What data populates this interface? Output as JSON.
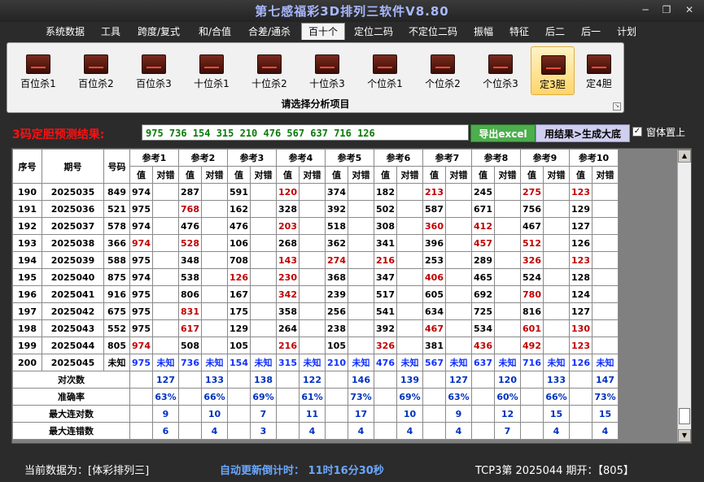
{
  "window": {
    "title": "第七感福彩3D排列三软件V8.80",
    "minimize": "─",
    "restore": "❐",
    "close": "✕"
  },
  "menu": [
    {
      "label": "系统数据",
      "active": false
    },
    {
      "label": "工具",
      "active": false
    },
    {
      "label": "跨度/复式",
      "active": false
    },
    {
      "label": "和/合值",
      "active": false
    },
    {
      "label": "合差/通杀",
      "active": false
    },
    {
      "label": "百十个",
      "active": true
    },
    {
      "label": "定位二码",
      "active": false
    },
    {
      "label": "不定位二码",
      "active": false
    },
    {
      "label": "振幅",
      "active": false
    },
    {
      "label": "特征",
      "active": false
    },
    {
      "label": "后二",
      "active": false
    },
    {
      "label": "后一",
      "active": false
    },
    {
      "label": "计划",
      "active": false
    }
  ],
  "ribbon": {
    "buttons": [
      {
        "label": "百位杀1",
        "icon": "chart-icon",
        "selected": false
      },
      {
        "label": "百位杀2",
        "icon": "chart-icon",
        "selected": false
      },
      {
        "label": "百位杀3",
        "icon": "chart-icon",
        "selected": false
      },
      {
        "label": "十位杀1",
        "icon": "chart-icon",
        "selected": false
      },
      {
        "label": "十位杀2",
        "icon": "chart-icon",
        "selected": false
      },
      {
        "label": "十位杀3",
        "icon": "chart-icon",
        "selected": false
      },
      {
        "label": "个位杀1",
        "icon": "chart-icon",
        "selected": false
      },
      {
        "label": "个位杀2",
        "icon": "chart-icon",
        "selected": false
      },
      {
        "label": "个位杀3",
        "icon": "chart-icon",
        "selected": false
      },
      {
        "label": "定3胆",
        "icon": "chart-icon",
        "selected": true
      },
      {
        "label": "定4胆",
        "icon": "chart-icon",
        "selected": false
      }
    ],
    "caption": "请选择分析项目"
  },
  "prediction": {
    "label": "3码定胆预测结果:",
    "value": "975  736  154  315  210  476  567  637  716  126",
    "export_label": "导出excel",
    "generate_label": "用结果>生成大底",
    "pin_label": "窗体置上",
    "pin_checked": true
  },
  "table": {
    "headers": {
      "seq": "序号",
      "period": "期号",
      "code": "号码",
      "value": "值",
      "check": "对错"
    },
    "refs": [
      "参考1",
      "参考2",
      "参考3",
      "参考4",
      "参考5",
      "参考6",
      "参考7",
      "参考8",
      "参考9",
      "参考10"
    ],
    "rows": [
      {
        "seq": "190",
        "period": "2025035",
        "code": "849",
        "cells": [
          [
            "974",
            "对2"
          ],
          [
            "287",
            "对1"
          ],
          [
            "591",
            "对1"
          ],
          [
            "120",
            ""
          ],
          [
            "374",
            "对1"
          ],
          [
            "182",
            "对1"
          ],
          [
            "213",
            ""
          ],
          [
            "245",
            "对1"
          ],
          [
            "275",
            ""
          ],
          [
            "123",
            ""
          ]
        ]
      },
      {
        "seq": "191",
        "period": "2025036",
        "code": "521",
        "cells": [
          [
            "975",
            "对1"
          ],
          [
            "768",
            ""
          ],
          [
            "162",
            "对2"
          ],
          [
            "328",
            "对1"
          ],
          [
            "392",
            "对1"
          ],
          [
            "502",
            "对2"
          ],
          [
            "587",
            "对1"
          ],
          [
            "671",
            "对1"
          ],
          [
            "756",
            "对1"
          ],
          [
            "129",
            "对2"
          ]
        ]
      },
      {
        "seq": "192",
        "period": "2025037",
        "code": "578",
        "cells": [
          [
            "974",
            "对1"
          ],
          [
            "476",
            "对1"
          ],
          [
            "476",
            "对1"
          ],
          [
            "203",
            ""
          ],
          [
            "518",
            "对2"
          ],
          [
            "308",
            "对1"
          ],
          [
            "360",
            ""
          ],
          [
            "412",
            ""
          ],
          [
            "467",
            "对1"
          ],
          [
            "127",
            "对1"
          ]
        ]
      },
      {
        "seq": "193",
        "period": "2025038",
        "code": "366",
        "cells": [
          [
            "974",
            ""
          ],
          [
            "528",
            ""
          ],
          [
            "106",
            "对2"
          ],
          [
            "268",
            "对2"
          ],
          [
            "362",
            "对3"
          ],
          [
            "341",
            "对1"
          ],
          [
            "396",
            "对3"
          ],
          [
            "457",
            ""
          ],
          [
            "512",
            ""
          ],
          [
            "126",
            "对2"
          ]
        ]
      },
      {
        "seq": "194",
        "period": "2025039",
        "code": "588",
        "cells": [
          [
            "975",
            "对1"
          ],
          [
            "348",
            "对2"
          ],
          [
            "708",
            "对2"
          ],
          [
            "143",
            ""
          ],
          [
            "274",
            ""
          ],
          [
            "216",
            ""
          ],
          [
            "253",
            "对1"
          ],
          [
            "289",
            "对2"
          ],
          [
            "326",
            ""
          ],
          [
            "123",
            ""
          ]
        ]
      },
      {
        "seq": "195",
        "period": "2025040",
        "code": "875",
        "cells": [
          [
            "974",
            "对1"
          ],
          [
            "538",
            "对2"
          ],
          [
            "126",
            ""
          ],
          [
            "230",
            ""
          ],
          [
            "368",
            "对1"
          ],
          [
            "347",
            "对1"
          ],
          [
            "406",
            ""
          ],
          [
            "465",
            "对1"
          ],
          [
            "524",
            "对1"
          ],
          [
            "128",
            "对1"
          ]
        ]
      },
      {
        "seq": "196",
        "period": "2025041",
        "code": "916",
        "cells": [
          [
            "975",
            "对1"
          ],
          [
            "806",
            "对1"
          ],
          [
            "167",
            "对2"
          ],
          [
            "342",
            ""
          ],
          [
            "239",
            "对1"
          ],
          [
            "517",
            "对1"
          ],
          [
            "605",
            "对1"
          ],
          [
            "692",
            "对2"
          ],
          [
            "780",
            ""
          ],
          [
            "124",
            "对1"
          ]
        ]
      },
      {
        "seq": "197",
        "period": "2025042",
        "code": "675",
        "cells": [
          [
            "975",
            "对2"
          ],
          [
            "831",
            ""
          ],
          [
            "175",
            "对2"
          ],
          [
            "358",
            "对1"
          ],
          [
            "256",
            "对2"
          ],
          [
            "541",
            "对1"
          ],
          [
            "634",
            "对1"
          ],
          [
            "725",
            "对2"
          ],
          [
            "816",
            "对1"
          ],
          [
            "127",
            "对1"
          ]
        ]
      },
      {
        "seq": "198",
        "period": "2025043",
        "code": "552",
        "cells": [
          [
            "975",
            "对1"
          ],
          [
            "617",
            ""
          ],
          [
            "129",
            "对1"
          ],
          [
            "264",
            "对1"
          ],
          [
            "238",
            "对1"
          ],
          [
            "392",
            "对1"
          ],
          [
            "467",
            ""
          ],
          [
            "534",
            "对2"
          ],
          [
            "601",
            ""
          ],
          [
            "130",
            ""
          ]
        ]
      },
      {
        "seq": "199",
        "period": "2025044",
        "code": "805",
        "cells": [
          [
            "974",
            ""
          ],
          [
            "508",
            "对3"
          ],
          [
            "105",
            "对2"
          ],
          [
            "216",
            ""
          ],
          [
            "105",
            "对2"
          ],
          [
            "326",
            ""
          ],
          [
            "381",
            "对1"
          ],
          [
            "436",
            ""
          ],
          [
            "492",
            ""
          ],
          [
            "123",
            ""
          ]
        ]
      }
    ],
    "pending_row": {
      "seq": "200",
      "period": "2025045",
      "code": "未知",
      "values": [
        "975",
        "736",
        "154",
        "315",
        "210",
        "476",
        "567",
        "637",
        "716",
        "126"
      ],
      "mark": "未知"
    },
    "stats": [
      {
        "label": "对次数",
        "values": [
          "127",
          "133",
          "138",
          "122",
          "146",
          "139",
          "127",
          "120",
          "133",
          "147"
        ]
      },
      {
        "label": "准确率",
        "values": [
          "63%",
          "66%",
          "69%",
          "61%",
          "73%",
          "69%",
          "63%",
          "60%",
          "66%",
          "73%"
        ]
      },
      {
        "label": "最大连对数",
        "values": [
          "9",
          "10",
          "7",
          "11",
          "17",
          "10",
          "9",
          "12",
          "15",
          "15"
        ]
      },
      {
        "label": "最大连错数",
        "values": [
          "6",
          "4",
          "3",
          "4",
          "4",
          "4",
          "4",
          "7",
          "4",
          "4"
        ]
      }
    ]
  },
  "status": {
    "current_data": "当前数据为：[体彩排列三]",
    "countdown": "自动更新倒计时：  11时16分30秒",
    "draw_info": "TCP3第 2025044 期开：【805】"
  }
}
